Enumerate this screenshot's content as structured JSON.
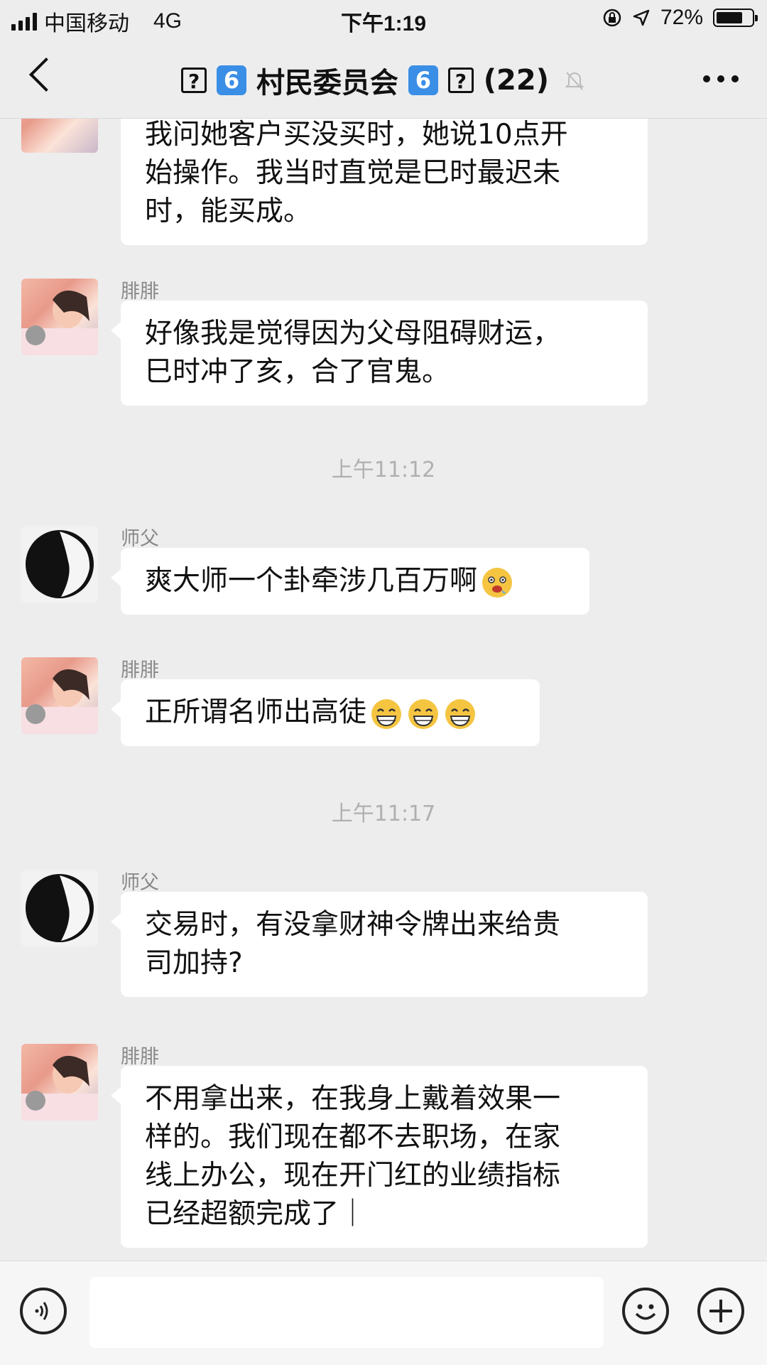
{
  "status": {
    "carrier": "中国移动",
    "network": "4G",
    "time": "下午1:19",
    "battery": "72%",
    "battery_level": 0.72
  },
  "nav": {
    "title": "🅂 6村民委员会6🅂(22)",
    "title_parts": {
      "unknown_glyph": "?",
      "num_badge": "6",
      "group_name": "村民委员会",
      "member_count": "(22)"
    }
  },
  "messages": {
    "m0": {
      "sender": "",
      "lines": [
        "我问她客户买没买时，她说10点开",
        "始操作。我当时直觉是巳时最迟未",
        "时，能买成。"
      ]
    },
    "m1": {
      "sender": "腓腓",
      "lines": [
        "好像我是觉得因为父母阻碍财运，",
        "巳时冲了亥，合了官鬼。"
      ]
    },
    "ts1": "上午11:12",
    "m2": {
      "sender": "师父",
      "text": "爽大师一个卦牵涉几百万啊",
      "emoji": "drooling-face-emoji"
    },
    "m3": {
      "sender": "腓腓",
      "text": "正所谓名师出高徒",
      "emoji": "grinning-face-emoji"
    },
    "ts2": "上午11:17",
    "m4": {
      "sender": "师父",
      "lines": [
        "交易时，有没拿财神令牌出来给贵",
        "司加持?"
      ]
    },
    "m5": {
      "sender": "腓腓",
      "lines": [
        "不用拿出来，在我身上戴着效果一",
        "样的。我们现在都不去职场，在家",
        "线上办公，现在开门红的业绩指标",
        "已经超额完成了｜"
      ]
    }
  },
  "input": {
    "value": ""
  }
}
